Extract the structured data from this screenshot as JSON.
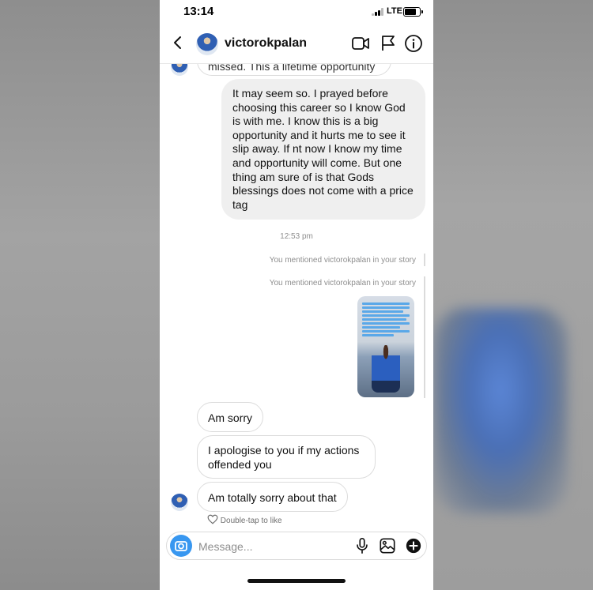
{
  "status_bar": {
    "time": "13:14",
    "network": "LTE"
  },
  "header": {
    "username": "victorokpalan"
  },
  "messages": {
    "partial_top": "missed. This a lifetime opportunity",
    "outgoing_long": "It may seem so. I prayed before choosing this career so I know God is with me. I know this is a big opportunity and it hurts me to see it slip away. If nt now I know my time and opportunity will come. But one thing am sure of is that Gods blessings does not come with a price tag",
    "timestamp": "12:53 pm",
    "mention_1": "You mentioned victorokpalan in your story",
    "mention_2": "You mentioned victorokpalan in your story",
    "incoming_1": "Am sorry",
    "incoming_2": "I apologise to you if my actions offended you",
    "incoming_3": "Am totally sorry about that",
    "like_hint": "Double-tap to like"
  },
  "composer": {
    "placeholder": "Message..."
  },
  "colors": {
    "accent": "#3897f0",
    "bubble_out": "#efefef",
    "muted_text": "#8e8e8e"
  },
  "icons": [
    "back-arrow-icon",
    "video-call-icon",
    "flag-icon",
    "info-icon",
    "camera-icon",
    "microphone-icon",
    "gallery-icon",
    "plus-icon",
    "heart-icon"
  ]
}
